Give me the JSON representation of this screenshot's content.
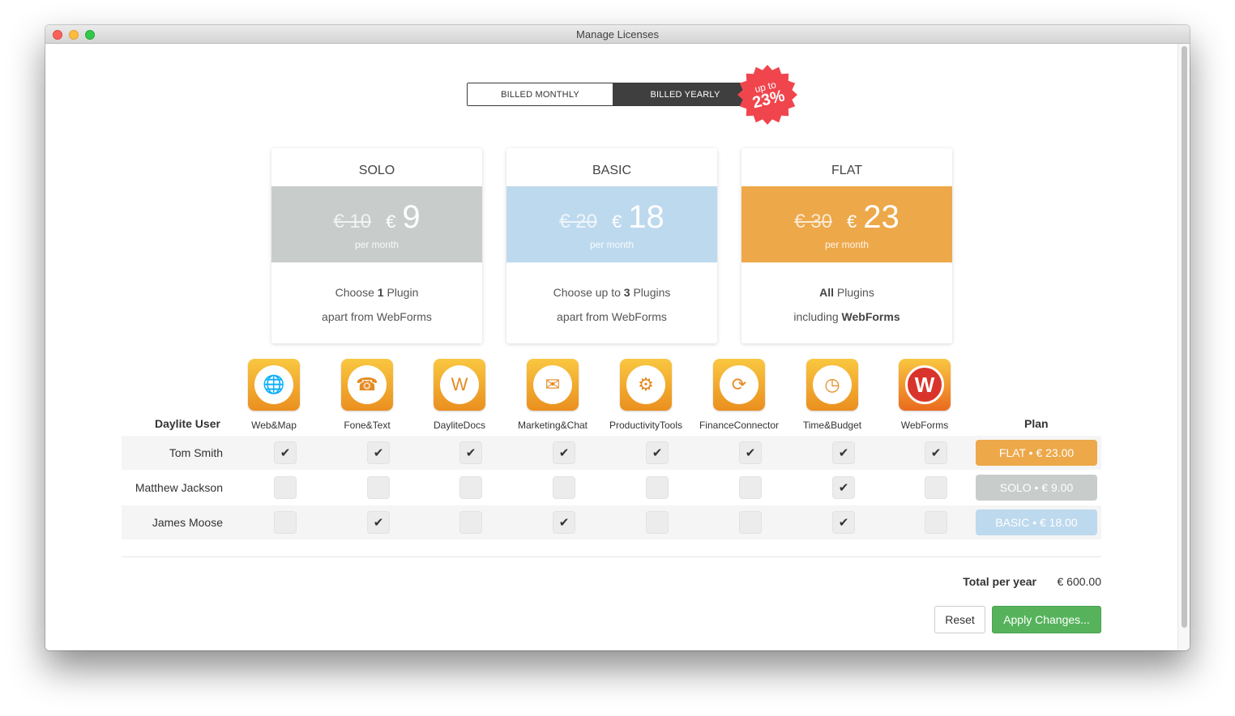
{
  "window": {
    "title": "Manage Licenses"
  },
  "billing": {
    "monthly_label": "BILLED MONTHLY",
    "yearly_label": "BILLED YEARLY",
    "selected": "yearly",
    "badge_line1": "up to",
    "badge_line2": "23%",
    "badge_color": "#f0454d"
  },
  "plans": [
    {
      "name": "SOLO",
      "old_price": "€ 10",
      "currency": "€",
      "price": "9",
      "per": "per month",
      "desc_pre1": "Choose ",
      "desc_bold1": "1",
      "desc_post1": " Plugin",
      "desc_line2_pre": "apart from WebForms",
      "desc_line2_bold": "",
      "color": "#c8cccb"
    },
    {
      "name": "BASIC",
      "old_price": "€ 20",
      "currency": "€",
      "price": "18",
      "per": "per month",
      "desc_pre1": "Choose up to ",
      "desc_bold1": "3",
      "desc_post1": " Plugins",
      "desc_line2_pre": "apart from WebForms",
      "desc_line2_bold": "",
      "color": "#bdd9ee"
    },
    {
      "name": "FLAT",
      "old_price": "€ 30",
      "currency": "€",
      "price": "23",
      "per": "per month",
      "desc_pre1": "",
      "desc_bold1": "All",
      "desc_post1": " Plugins",
      "desc_line2_pre": "including ",
      "desc_line2_bold": "WebForms",
      "color": "#eda84a"
    }
  ],
  "plugins": [
    {
      "name": "Web&Map",
      "icon": "globe-map-icon",
      "glyph": "🌐"
    },
    {
      "name": "Fone&Text",
      "icon": "phone-chat-icon",
      "glyph": "☎"
    },
    {
      "name": "DayliteDocs",
      "icon": "documents-icon",
      "glyph": "W"
    },
    {
      "name": "Marketing&Chat",
      "icon": "mail-chat-icon",
      "glyph": "✉"
    },
    {
      "name": "ProductivityTools",
      "icon": "tools-gear-icon",
      "glyph": "⚙"
    },
    {
      "name": "FinanceConnector",
      "icon": "calculator-sync-icon",
      "glyph": "⟳"
    },
    {
      "name": "Time&Budget",
      "icon": "clock-money-icon",
      "glyph": "◷"
    },
    {
      "name": "WebForms",
      "icon": "webforms-logo-icon",
      "glyph": "W"
    }
  ],
  "table": {
    "user_header": "Daylite User",
    "plan_header": "Plan",
    "rows": [
      {
        "user": "Tom Smith",
        "checks": [
          true,
          true,
          true,
          true,
          true,
          true,
          true,
          true
        ],
        "plan_label": "FLAT • € 23.00",
        "plan_color": "#eda84a"
      },
      {
        "user": "Matthew Jackson",
        "checks": [
          false,
          false,
          false,
          false,
          false,
          false,
          true,
          false
        ],
        "plan_label": "SOLO • € 9.00",
        "plan_color": "#c8cccb"
      },
      {
        "user": "James Moose",
        "checks": [
          false,
          true,
          false,
          true,
          false,
          false,
          true,
          false
        ],
        "plan_label": "BASIC • € 18.00",
        "plan_color": "#bdd9ee"
      }
    ]
  },
  "footer": {
    "total_label": "Total per year",
    "total_value": "€ 600.00",
    "reset_label": "Reset",
    "apply_label": "Apply Changes..."
  }
}
